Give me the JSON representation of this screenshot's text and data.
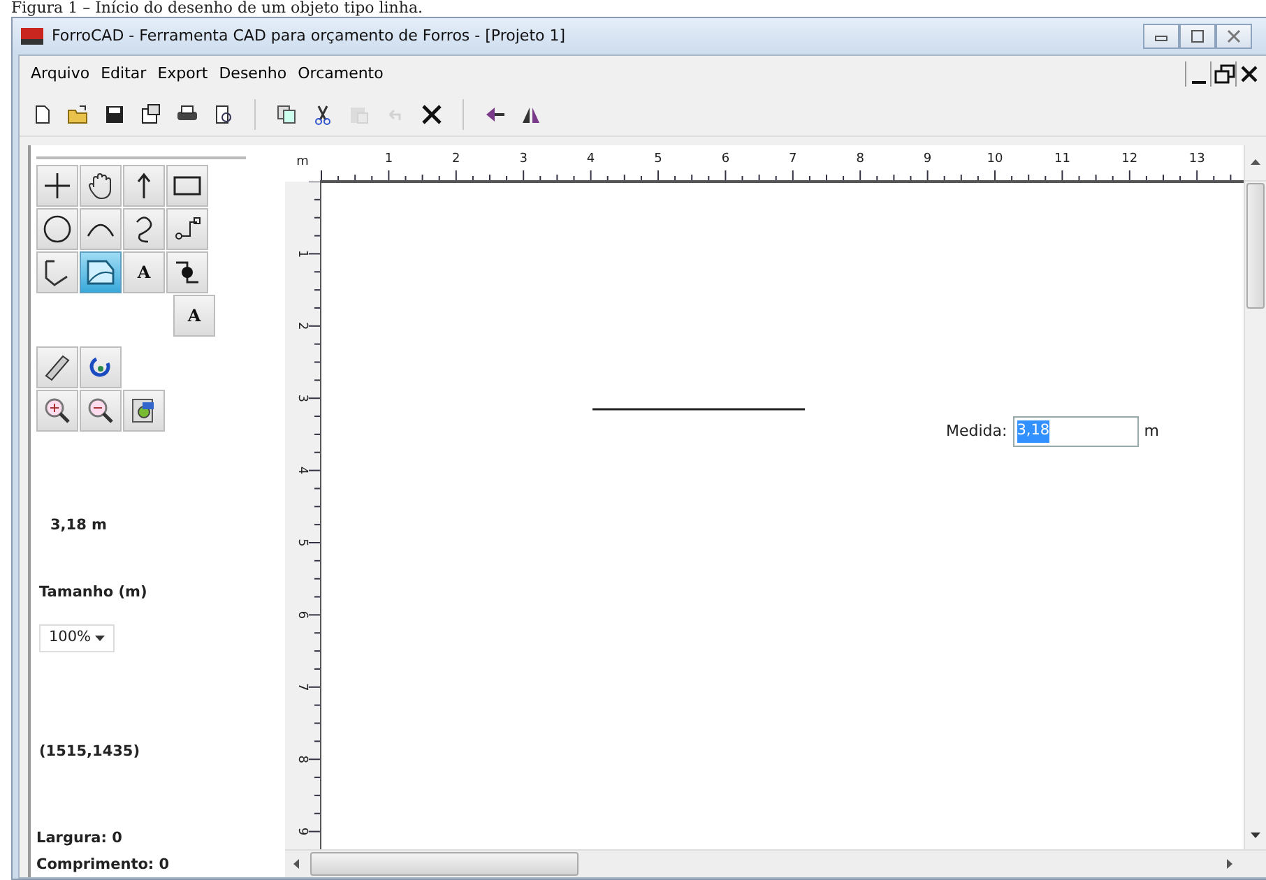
{
  "caption": "Figura 1 – Início do desenho de um objeto tipo linha.",
  "window": {
    "title": "ForroCAD - Ferramenta CAD para orçamento de Forros - [Projeto 1]"
  },
  "menu": [
    "Arquivo",
    "Editar",
    "Export",
    "Desenho",
    "Orcamento"
  ],
  "toolbar": [
    [
      {
        "disabled": false
      },
      {
        "disabled": false
      },
      {
        "disabled": false
      },
      {
        "disabled": false
      },
      {
        "disabled": false
      },
      {
        "disabled": false
      }
    ],
    [
      {
        "disabled": false
      },
      {
        "disabled": false
      },
      {
        "disabled": true
      },
      {
        "disabled": true
      },
      {
        "disabled": false
      }
    ],
    [
      {
        "disabled": false
      },
      {
        "disabled": false
      }
    ]
  ],
  "tool_rows": [
    [
      {
        "selected": false
      },
      {
        "selected": false
      },
      {
        "selected": false
      },
      {
        "selected": false
      }
    ],
    [
      {
        "selected": false
      },
      {
        "selected": false
      },
      {
        "selected": false
      },
      {
        "selected": false
      }
    ],
    [
      {
        "selected": false
      },
      {
        "selected": true
      },
      {
        "selected": false,
        "label": "A"
      },
      {
        "selected": false
      }
    ],
    [
      {
        "selected": false,
        "label": "A"
      }
    ],
    [
      {
        "selected": false
      },
      {
        "selected": false
      }
    ],
    [
      {
        "selected": false
      },
      {
        "selected": false
      },
      {
        "selected": false
      }
    ]
  ],
  "panel": {
    "measure": "3,18 m",
    "size_label": "Tamanho (m)",
    "zoom": "100%",
    "coords": "(1515,1435)",
    "width": "Largura: 0",
    "length": "Comprimento: 0"
  },
  "ruler": {
    "unit": "m",
    "x_labels": [
      "1",
      "2",
      "3",
      "4",
      "5",
      "6",
      "7",
      "8",
      "9",
      "10",
      "11",
      "12",
      "13"
    ],
    "y_labels": [
      "1",
      "2",
      "3",
      "4",
      "5",
      "6",
      "7",
      "8",
      "9"
    ]
  },
  "measure_popup": {
    "label": "Medida:",
    "value": "3,18",
    "unit": "m"
  }
}
